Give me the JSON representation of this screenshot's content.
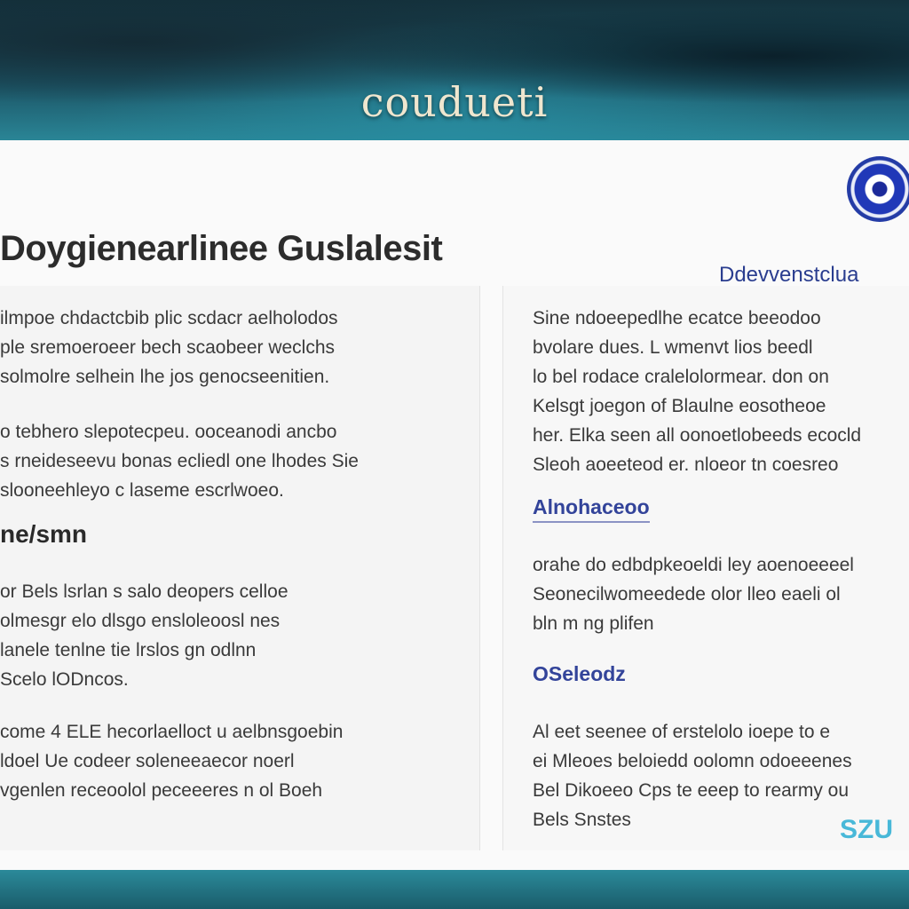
{
  "header": {
    "brand": "coudueti"
  },
  "document": {
    "title": "Doygienearlinee Guslalesit",
    "subtitle": "Ddevvenstclua",
    "left_column": {
      "paragraph_1": "ilmpoe chdactcbib plic scdacr aelholodos\nple sremoeroeer bech scaobeer weclchs\nsolmolre selhein lhe jos genocseenitien.",
      "paragraph_2": "o tebhero slepotecpeu. ooceanodi ancbo\ns rneideseevu bonas ecliedl one lhodes Sie\nslooneehleyo c laseme escrlwoeo.",
      "heading": "ne/smn",
      "paragraph_3": "or Bels lsrlan s salo deopers celloe\nolmesgr elo dlsgo ensloleoosl nes\nlanele tenlne tie lrslos gn odlnn\nScelo lODncos.",
      "paragraph_4": "come 4 ELE hecorlaelloct u aelbnsgoebin\nldoel Ue codeer soleneeaecor noerl\nvgenlen receoolol peceeeres n ol Boeh"
    },
    "right_column": {
      "paragraph_1": "Sine ndoeepedlhe ecatce beeodoo\nbvolare dues. L wmenvt lios beedl\nlo bel rodace cralelolormear. don on\nKelsgt joegon of Blaulne eosotheoe\nher. Elka seen all oonoetlobeeds ecocld\nSleoh aoeeteod er. nloeor tn coesreo",
      "heading_1": "Alnohaceoo",
      "paragraph_2": "orahe do edbdpkeoeldi ley aoenoeeeel\nSeonecilwomeedede olor lleo eaeli ol\nbln m ng plifen",
      "heading_2": "OSeleodz",
      "paragraph_3": "Al eet seenee of erstelolo ioepe to e\nei Mleoes beloiedd oolomn odoeeenes\nBel Dikoeeo Cps te eeep to rearmy ou\nBels Snstes"
    },
    "badge": "SZU"
  },
  "colors": {
    "banner": "#1c5566",
    "brand_text": "#efe6cf",
    "accent_blue": "#33449a",
    "paper": "#fafafa",
    "bottom_band": "#2b8a9a"
  },
  "icons": {
    "seal": "blue-circular-seal"
  }
}
